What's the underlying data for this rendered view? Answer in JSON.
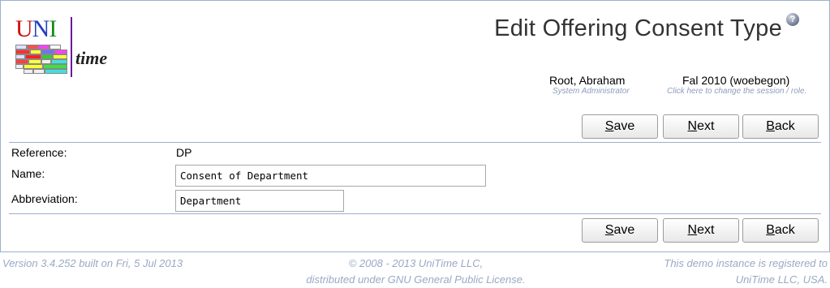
{
  "logo": {
    "letters": [
      "U",
      "N",
      "I"
    ],
    "word": "time"
  },
  "page_title": "Edit Offering Consent Type",
  "help_icon": "help-icon",
  "user": {
    "name": "Root, Abraham",
    "role": "System Administrator"
  },
  "session": {
    "name": "Fal 2010 (woebegon)",
    "hint": "Click here to change the session / role."
  },
  "buttons": {
    "save": {
      "pre": "",
      "acc": "S",
      "post": "ave"
    },
    "next": {
      "pre": "",
      "acc": "N",
      "post": "ext"
    },
    "back": {
      "pre": "",
      "acc": "B",
      "post": "ack"
    }
  },
  "form": {
    "reference_label": "Reference:",
    "reference_value": "DP",
    "name_label": "Name:",
    "name_value": "Consent of Department",
    "abbreviation_label": "Abbreviation:",
    "abbreviation_value": "Department"
  },
  "footer": {
    "version": "Version 3.4.252 built on Fri, 5 Jul 2013",
    "copyright_line1": "© 2008 - 2013 UniTime LLC,",
    "copyright_line2": "distributed under GNU General Public License.",
    "registered_line1": "This demo instance is registered to",
    "registered_line2": "UniTime LLC, USA."
  },
  "colors": {
    "accent": "#9cb0ce",
    "hint": "#8d9dbc",
    "footer": "#9aa9c4"
  }
}
